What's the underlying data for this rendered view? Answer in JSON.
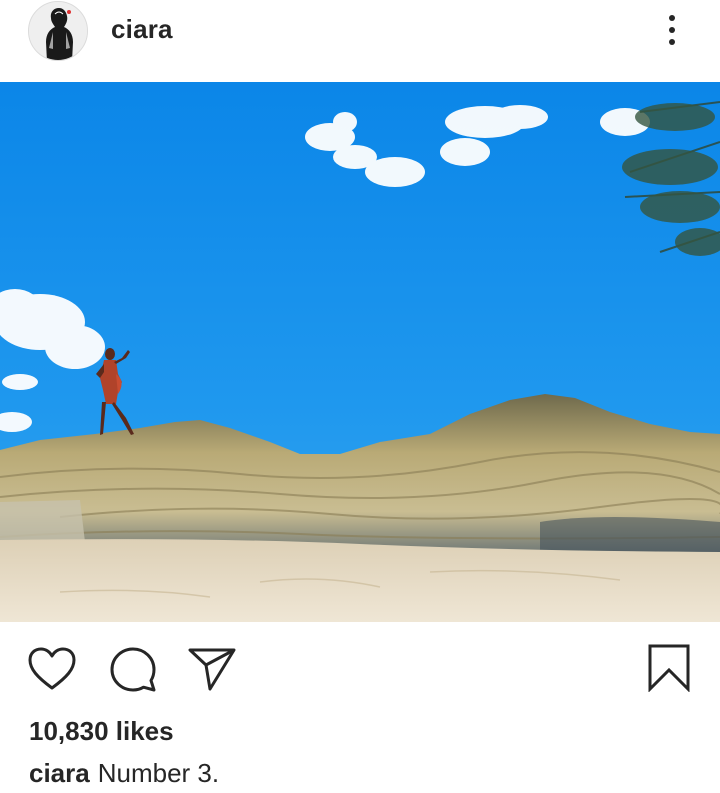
{
  "post": {
    "username": "ciara",
    "likes": "10,830 likes",
    "caption_user": "ciara",
    "caption_text": "Number 3."
  },
  "icons": {
    "more": "more-vertical-icon",
    "like": "heart-icon",
    "comment": "comment-icon",
    "share": "send-icon",
    "save": "bookmark-icon"
  },
  "colors": {
    "text": "#262626",
    "sky": "#1d8fe6",
    "sand": "#e8dcc6",
    "rock": "#b5a57a"
  }
}
